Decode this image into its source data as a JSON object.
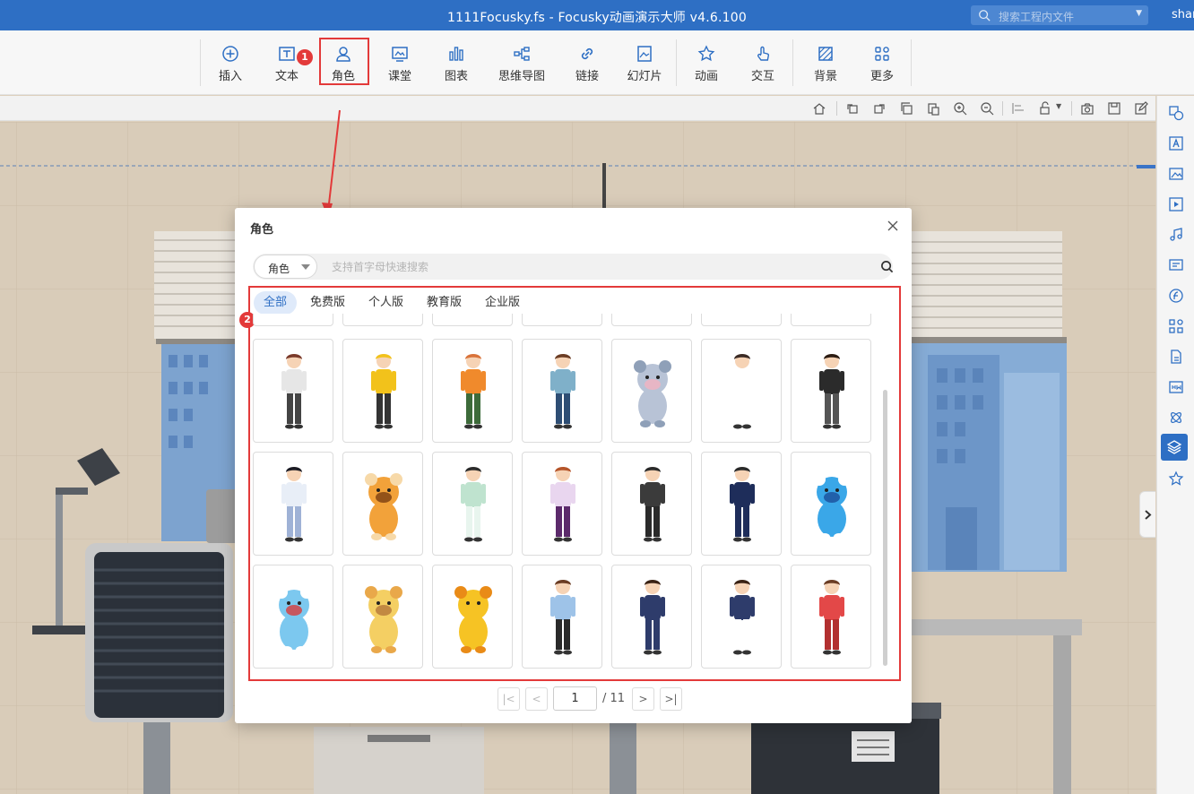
{
  "window": {
    "title": "1111Focusky.fs - Focusky动画演示大师  v4.6.100",
    "search_placeholder": "搜索工程内文件",
    "user": "shar"
  },
  "toolbar": {
    "items": [
      {
        "label": "插入",
        "icon": "plus-circle-icon"
      },
      {
        "label": "文本",
        "icon": "text-icon"
      },
      {
        "label": "角色",
        "icon": "user-icon"
      },
      {
        "label": "课堂",
        "icon": "classroom-icon"
      },
      {
        "label": "图表",
        "icon": "bar-chart-icon"
      },
      {
        "label": "思维导图",
        "icon": "mindmap-icon"
      },
      {
        "label": "链接",
        "icon": "link-icon"
      },
      {
        "label": "幻灯片",
        "icon": "slide-icon"
      },
      {
        "label": "动画",
        "icon": "star-icon"
      },
      {
        "label": "交互",
        "icon": "hand-pointer-icon"
      },
      {
        "label": "背景",
        "icon": "background-icon"
      },
      {
        "label": "更多",
        "icon": "grid-more-icon"
      }
    ]
  },
  "annotations": {
    "badge_1": "1",
    "badge_2": "2"
  },
  "dialog": {
    "title": "角色",
    "category_select": "角色",
    "search_placeholder": "支持首字母快速搜索",
    "tabs": [
      {
        "label": "全部",
        "active": true
      },
      {
        "label": "免费版",
        "active": false
      },
      {
        "label": "个人版",
        "active": false
      },
      {
        "label": "教育版",
        "active": false
      },
      {
        "label": "企业版",
        "active": false
      }
    ],
    "characters": [
      {
        "name": "girl-phone-character",
        "colors": [
          "#e6e6e6",
          "#444444",
          "#7a3a2a"
        ]
      },
      {
        "name": "delivery-rider-character",
        "colors": [
          "#f2c21b",
          "#333333",
          "#f2c21b"
        ]
      },
      {
        "name": "boy-orange-shirt-character",
        "colors": [
          "#f08a2c",
          "#3d6b3a",
          "#d9733a"
        ]
      },
      {
        "name": "boy-backpack-character",
        "colors": [
          "#7fb0c9",
          "#2e4e74",
          "#6b3d24"
        ]
      },
      {
        "name": "mouse-character",
        "colors": [
          "#b8c3d6",
          "#8fa0b8",
          "#f3b3c0"
        ]
      },
      {
        "name": "nurse-character",
        "colors": [
          "#ffffff",
          "#ffffff",
          "#3a2a24"
        ]
      },
      {
        "name": "businesswoman-dark-character",
        "colors": [
          "#2b2b2b",
          "#555555",
          "#2b1b12"
        ]
      },
      {
        "name": "girl-uniform-character",
        "colors": [
          "#e8eef7",
          "#9fb2d6",
          "#1b1b24"
        ]
      },
      {
        "name": "tiger-character",
        "colors": [
          "#f2a23a",
          "#f7d9a8",
          "#7a3f12"
        ]
      },
      {
        "name": "ancient-lady-character",
        "colors": [
          "#bfe3cf",
          "#e8f5ee",
          "#2b2b2b"
        ]
      },
      {
        "name": "woman-purple-character",
        "colors": [
          "#e9d6ef",
          "#5c2a6b",
          "#b5552a"
        ]
      },
      {
        "name": "boss-man-character",
        "colors": [
          "#3b3b3b",
          "#2a2a2a",
          "#2a2a2a"
        ]
      },
      {
        "name": "officer-character",
        "colors": [
          "#1e2d5a",
          "#1e2d5a",
          "#2a2a2a"
        ]
      },
      {
        "name": "water-drop-mascot-character",
        "colors": [
          "#3aa7e8",
          "#ffffff",
          "#1b4f9a"
        ]
      },
      {
        "name": "water-drop-mascot-2-character",
        "colors": [
          "#7cc8ef",
          "#ffffff",
          "#d93b3b"
        ]
      },
      {
        "name": "giraffe-character",
        "colors": [
          "#f4cf63",
          "#e9a84a",
          "#b5773a"
        ]
      },
      {
        "name": "lion-character",
        "colors": [
          "#f6c324",
          "#e98b17",
          "#f6c324"
        ]
      },
      {
        "name": "man-blue-shirt-character",
        "colors": [
          "#9ec3e8",
          "#2a2a2a",
          "#6b3d24"
        ]
      },
      {
        "name": "businessman-character",
        "colors": [
          "#2e3c6b",
          "#2e3c6b",
          "#3a2214"
        ]
      },
      {
        "name": "businesswoman-character",
        "colors": [
          "#2e3c6b",
          "#ffffff",
          "#3a2214"
        ]
      },
      {
        "name": "boy-red-tank-character",
        "colors": [
          "#e34848",
          "#b23030",
          "#6b3d24"
        ]
      }
    ],
    "pagination": {
      "current": "1",
      "total": "/ 11"
    }
  },
  "accent_color": "#2e6fc4",
  "highlight_color": "#e33a3a"
}
